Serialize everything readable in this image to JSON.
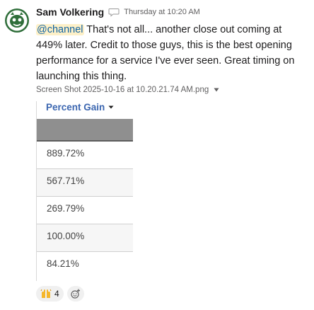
{
  "message": {
    "author": "Sam Volkering",
    "timestamp": "Thursday at 10:20 AM",
    "mention": "@channel",
    "text": " That's not all... another close out coming at 449% later. Credit to those guys, this is the best opening performance for a service I've ever seen. Great timing on launching this thing."
  },
  "attachment": {
    "filename": "Screen Shot 2025-10-16 at 10.20.21.74 AM.png"
  },
  "table": {
    "column_header": "Percent Gain",
    "rows": [
      "889.72%",
      "567.71%",
      "269.79%",
      "100.00%",
      "84.21%"
    ]
  },
  "reactions": [
    {
      "emoji": "raised-hands-icon",
      "count": "4"
    }
  ],
  "colors": {
    "mention_bg": "#fdf0c8",
    "mention_text": "#1264a3",
    "table_header_text": "#3b66b0"
  }
}
